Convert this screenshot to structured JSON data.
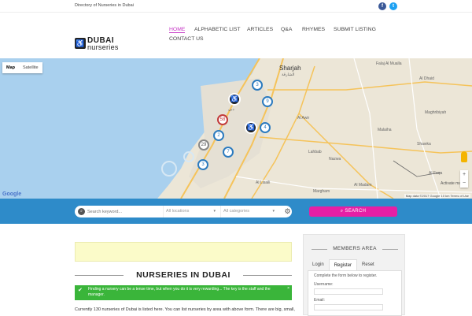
{
  "topbar": {
    "tagline": "Directory of Nurseries in Dubai"
  },
  "logo": {
    "word1": "DUBAI",
    "word2": "nurseries"
  },
  "nav": {
    "home": "HOME",
    "alphabetic": "ALPHABETIC LIST",
    "articles": "ARTICLES",
    "qa": "Q&A",
    "rhymes": "RHYMES",
    "submit": "SUBMIT LISTING",
    "contact": "CONTACT US"
  },
  "map": {
    "tab_map": "Map",
    "tab_satellite": "Satellite",
    "labels": {
      "sharjah": "Sharjah",
      "sharjah_ar": "الشارقة",
      "dubai_ar": "دبي",
      "al_dhaid": "Al Dhaid",
      "falaj": "Falaj Al Mualla",
      "maghribiyah": "Maghribiyah",
      "al_awir": "Al Awir",
      "lahbab": "Lahbab",
      "nazwa": "Nazwa",
      "malaiha": "Malaiha",
      "shawka": "Shawka",
      "al_madam": "Al Madam",
      "margham": "Margham",
      "al_lisaili": "Al Lisaili",
      "al_faqa": "Al Faqa"
    },
    "clusters": [
      "3",
      "9",
      "58",
      "4",
      "2",
      "29",
      "7",
      "3"
    ],
    "activate": "Activate map",
    "google": "Google",
    "footer": "Map data ©2017 Google   10 km   Terms of Use"
  },
  "search": {
    "keyword_placeholder": "Search keyword...",
    "locations": "All locations",
    "categories": "All categories",
    "button": "SEARCH"
  },
  "content": {
    "title": "NURSERIES IN DUBAI",
    "notice": "Finding a nursery can be a tense time, but when you do it is very rewarding... The key is the staff and the manager.",
    "notice_close": "×",
    "intro": "Currently 130 nurseries of Dubai is listed here. You can list nurseries by area with above form. There are big, small,"
  },
  "sidebar": {
    "title": "MEMBERS AREA",
    "tabs": [
      "Login",
      "Register",
      "Reset"
    ],
    "info": "Complete the form below to register.",
    "username_label": "Username:",
    "email_label": "Email:"
  }
}
